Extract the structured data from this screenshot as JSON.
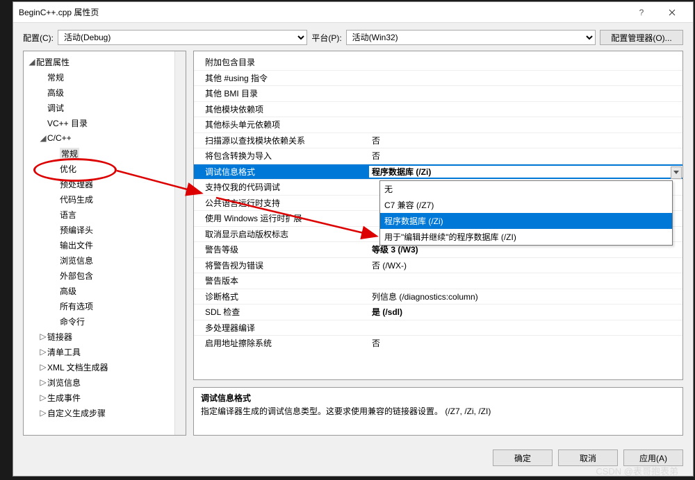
{
  "titlebar": {
    "title": "BeginC++.cpp 属性页"
  },
  "config": {
    "config_label": "配置(C):",
    "config_selected": "活动(Debug)",
    "platform_label": "平台(P):",
    "platform_selected": "活动(Win32)",
    "mgr_btn": "配置管理器(O)..."
  },
  "tree": [
    {
      "label": "配置属性",
      "depth": 0,
      "expanded": true
    },
    {
      "label": "常规",
      "depth": 1
    },
    {
      "label": "高级",
      "depth": 1
    },
    {
      "label": "调试",
      "depth": 1
    },
    {
      "label": "VC++ 目录",
      "depth": 1
    },
    {
      "label": "C/C++",
      "depth": 1,
      "expanded": true
    },
    {
      "label": "常规",
      "depth": 2,
      "selected": true
    },
    {
      "label": "优化",
      "depth": 2
    },
    {
      "label": "预处理器",
      "depth": 2
    },
    {
      "label": "代码生成",
      "depth": 2
    },
    {
      "label": "语言",
      "depth": 2
    },
    {
      "label": "预编译头",
      "depth": 2
    },
    {
      "label": "输出文件",
      "depth": 2
    },
    {
      "label": "浏览信息",
      "depth": 2
    },
    {
      "label": "外部包含",
      "depth": 2
    },
    {
      "label": "高级",
      "depth": 2
    },
    {
      "label": "所有选项",
      "depth": 2
    },
    {
      "label": "命令行",
      "depth": 2
    },
    {
      "label": "链接器",
      "depth": 1,
      "collapsed": true
    },
    {
      "label": "清单工具",
      "depth": 1,
      "collapsed": true
    },
    {
      "label": "XML 文档生成器",
      "depth": 1,
      "collapsed": true
    },
    {
      "label": "浏览信息",
      "depth": 1,
      "collapsed": true
    },
    {
      "label": "生成事件",
      "depth": 1,
      "collapsed": true
    },
    {
      "label": "自定义生成步骤",
      "depth": 1,
      "collapsed": true
    }
  ],
  "grid": [
    {
      "k": "附加包含目录",
      "v": ""
    },
    {
      "k": "其他 #using 指令",
      "v": ""
    },
    {
      "k": "其他 BMI 目录",
      "v": ""
    },
    {
      "k": "其他模块依赖项",
      "v": ""
    },
    {
      "k": "其他标头单元依赖项",
      "v": ""
    },
    {
      "k": "扫描源以查找模块依赖关系",
      "v": "否"
    },
    {
      "k": "将包含转换为导入",
      "v": "否"
    },
    {
      "k": "调试信息格式",
      "v": "程序数据库 (/Zi)",
      "selected": true,
      "bold": true
    },
    {
      "k": "支持仅我的代码调试",
      "v": ""
    },
    {
      "k": "公共语言运行时支持",
      "v": ""
    },
    {
      "k": "使用 Windows 运行时扩展",
      "v": ""
    },
    {
      "k": "取消显示启动版权标志",
      "v": ""
    },
    {
      "k": "警告等级",
      "v": "等级 3 (/W3)",
      "bold": true
    },
    {
      "k": "将警告视为错误",
      "v": "否 (/WX-)"
    },
    {
      "k": "警告版本",
      "v": ""
    },
    {
      "k": "诊断格式",
      "v": "列信息 (/diagnostics:column)"
    },
    {
      "k": "SDL 检查",
      "v": "是 (/sdl)",
      "bold": true
    },
    {
      "k": "多处理器编译",
      "v": ""
    },
    {
      "k": "启用地址擦除系统",
      "v": "否"
    }
  ],
  "dropdown": {
    "options": [
      {
        "label": "无"
      },
      {
        "label": "C7 兼容 (/Z7)"
      },
      {
        "label": "程序数据库 (/Zi)",
        "selected": true
      },
      {
        "label": "用于\"编辑并继续\"的程序数据库 (/ZI)"
      }
    ]
  },
  "desc": {
    "title": "调试信息格式",
    "body": "指定编译器生成的调试信息类型。这要求使用兼容的链接器设置。   (/Z7, /Zi, /ZI)"
  },
  "buttons": {
    "ok": "确定",
    "cancel": "取消",
    "apply": "应用(A)"
  },
  "watermark": "CSDN @表哥抱表弟"
}
